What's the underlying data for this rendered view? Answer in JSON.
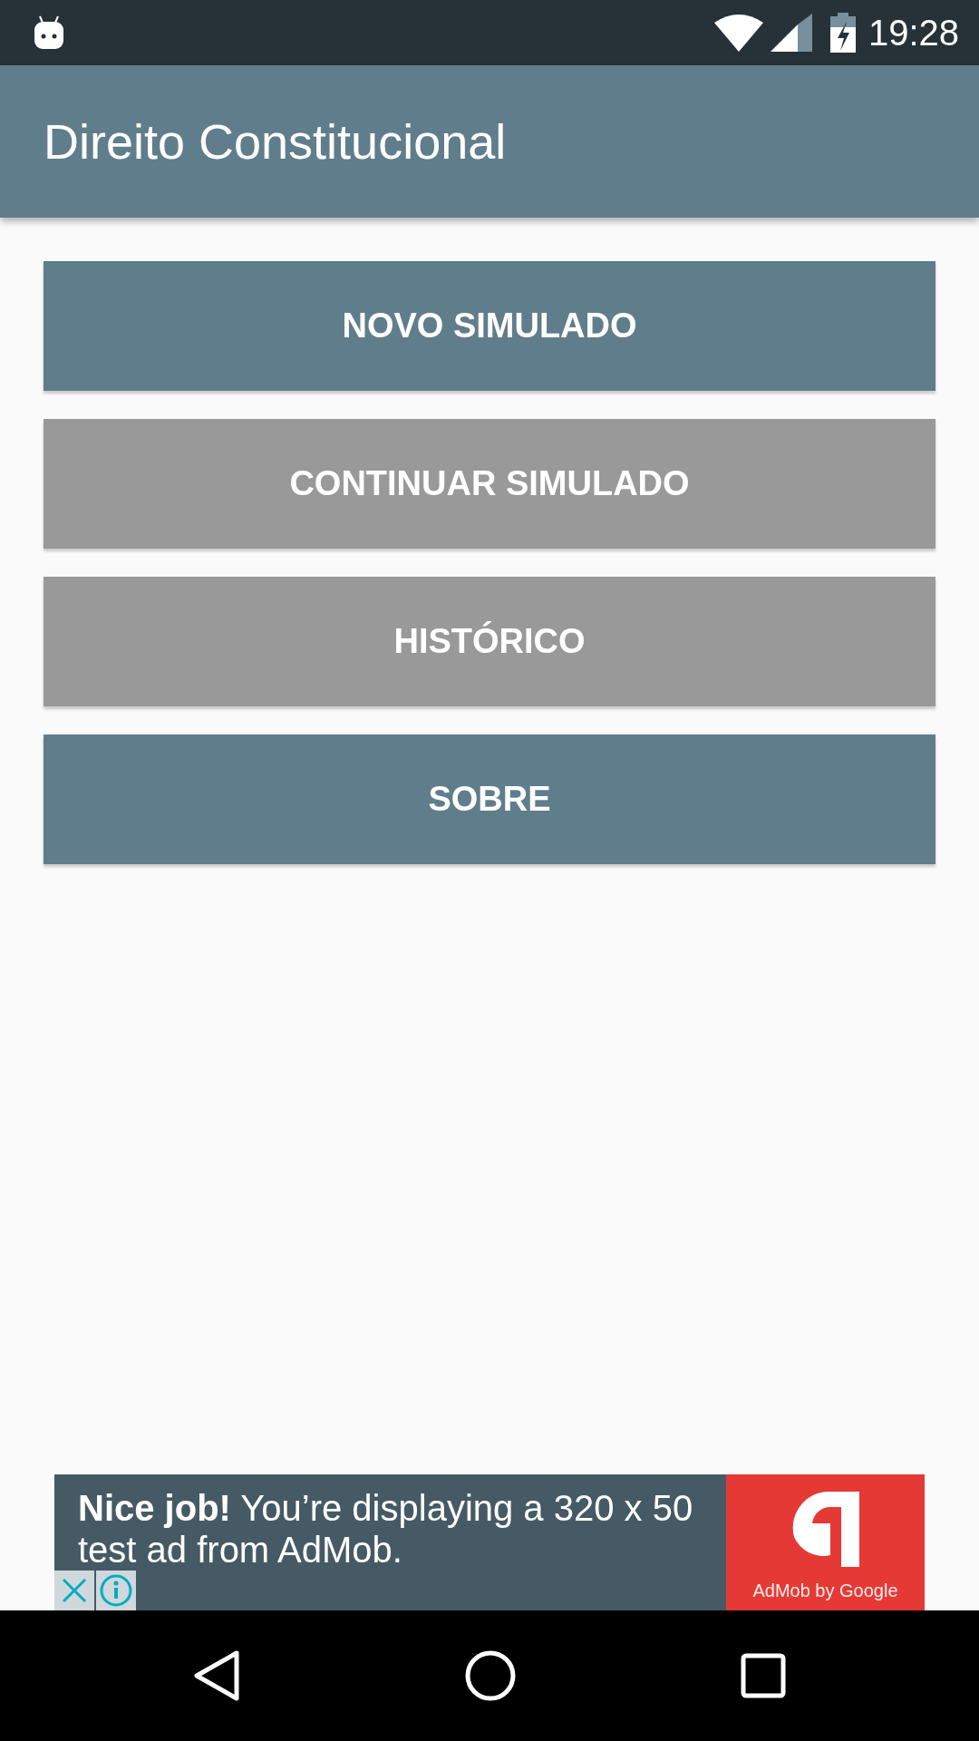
{
  "status_bar": {
    "time": "19:28"
  },
  "app_bar": {
    "title": "Direito Constitucional"
  },
  "buttons": [
    {
      "label": "NOVO SIMULADO",
      "disabled": false
    },
    {
      "label": "CONTINUAR SIMULADO",
      "disabled": true
    },
    {
      "label": "HISTÓRICO",
      "disabled": true
    },
    {
      "label": "SOBRE",
      "disabled": false
    }
  ],
  "ad": {
    "text": "**Nice job!** You’re displaying a 320 x 50 test ad from AdMob.",
    "brand": "AdMob by Google"
  }
}
